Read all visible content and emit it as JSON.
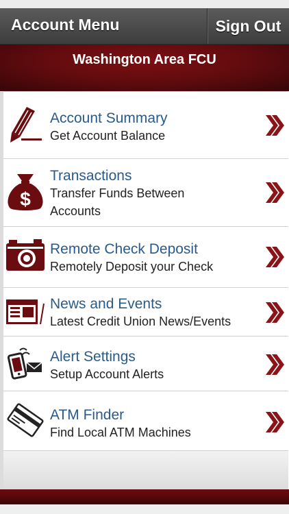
{
  "header": {
    "title": "Account Menu",
    "sign_out_label": "Sign Out"
  },
  "banner": {
    "title": "Washington Area FCU"
  },
  "menu": [
    {
      "title": "Account Summary",
      "subtitle": "Get Account Balance",
      "icon": "pencil-icon"
    },
    {
      "title": "Transactions",
      "subtitle": "Transfer Funds Between Accounts",
      "icon": "money-bag-icon"
    },
    {
      "title": "Remote Check Deposit",
      "subtitle": "Remotely Deposit your Check",
      "icon": "camera-icon"
    },
    {
      "title": "News and Events",
      "subtitle": "Latest Credit Union News/Events",
      "icon": "newspaper-icon"
    },
    {
      "title": "Alert Settings",
      "subtitle": "Setup Account Alerts",
      "icon": "phone-alert-icon"
    },
    {
      "title": "ATM Finder",
      "subtitle": "Find Local ATM Machines",
      "icon": "atm-card-icon"
    }
  ],
  "colors": {
    "brand": "#6b0c10",
    "link": "#2a5a8c",
    "header": "#4a4a4a"
  }
}
